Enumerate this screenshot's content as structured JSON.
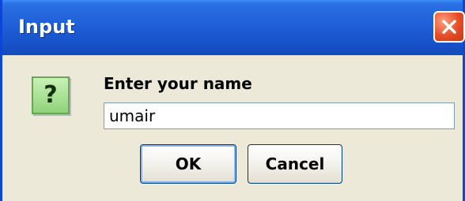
{
  "window": {
    "title": "Input"
  },
  "dialog": {
    "icon": "question-icon",
    "icon_glyph": "?",
    "prompt": "Enter your name",
    "input_value": "umair",
    "ok_label": "OK",
    "cancel_label": "Cancel"
  },
  "colors": {
    "titlebar": "#1f5fd8",
    "close_button": "#e44d26",
    "dialog_bg": "#ece9d8",
    "icon_bg": "#8fd27a"
  }
}
